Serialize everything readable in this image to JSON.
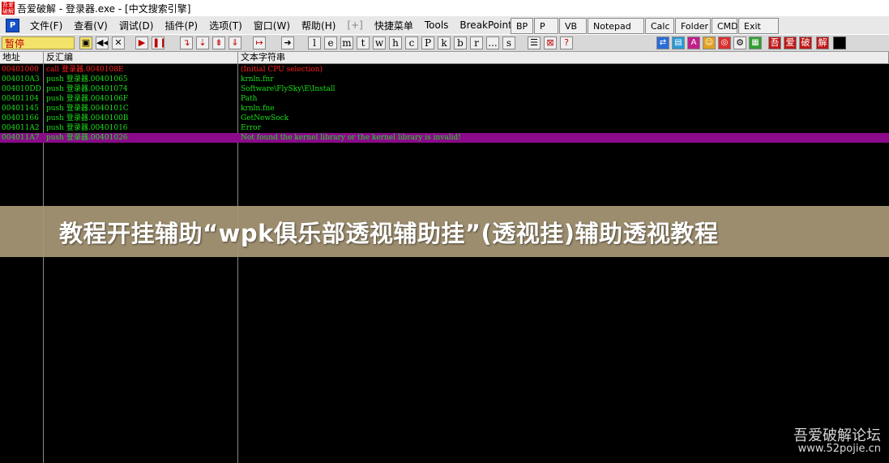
{
  "window": {
    "app_icon_text": "吾爱破解",
    "title": "吾爱破解 - 登录器.exe - [中文搜索引擎]"
  },
  "menu": {
    "p_icon": "P",
    "items": [
      "文件(F)",
      "查看(V)",
      "调试(D)",
      "插件(P)",
      "选项(T)",
      "窗口(W)",
      "帮助(H)",
      "[+]",
      "快捷菜单",
      "Tools",
      "BreakPoint->"
    ]
  },
  "quick_buttons": [
    "BP",
    "P",
    "VB",
    "Notepad",
    "Calc",
    "Folder",
    "CMD",
    "Exit"
  ],
  "toolbar": {
    "pause_label": "暂停",
    "letters": [
      "l",
      "e",
      "m",
      "t",
      "w",
      "h",
      "c",
      "P",
      "k",
      "b",
      "r",
      "...",
      "s"
    ],
    "help_icon": "?",
    "brand_buttons": [
      "吾",
      "爱",
      "破",
      "解"
    ]
  },
  "columns": {
    "address": "地址",
    "disasm": "反汇编",
    "text": "文本字符串"
  },
  "rows": [
    {
      "addr": "00401000",
      "instr": "call",
      "target": "登录器.0040108E",
      "text": "(Initial CPU selection)"
    },
    {
      "addr": "004010A3",
      "instr": "push",
      "target": "登录器.00401065",
      "text": "krnln.fnr"
    },
    {
      "addr": "004010DD",
      "instr": "push",
      "target": "登录器.00401074",
      "text": "Software\\FlySky\\E\\Install"
    },
    {
      "addr": "00401104",
      "instr": "push",
      "target": "登录器.0040106F",
      "text": "Path"
    },
    {
      "addr": "00401145",
      "instr": "push",
      "target": "登录器.0040101C",
      "text": "krnln.fne"
    },
    {
      "addr": "00401166",
      "instr": "push",
      "target": "登录器.0040100B",
      "text": "GetNewSock"
    },
    {
      "addr": "004011A2",
      "instr": "push",
      "target": "登录器.00401016",
      "text": "Error"
    },
    {
      "addr": "004011A7",
      "instr": "push",
      "target": "登录器.00401026",
      "text": "Not found the kernel library or the kernel library is invalid!"
    }
  ],
  "banner": {
    "text": "教程开挂辅助“wpk俱乐部透视辅助挂”(透视挂)辅助透视教程"
  },
  "watermark": {
    "line1": "吾爱破解论坛",
    "line2": "www.52pojie.cn"
  },
  "colors": {
    "row_first": "#ff2020",
    "row_normal": "#18e018",
    "row_selected_bg": "#8a0a8a",
    "banner_bg": "#a89876"
  }
}
